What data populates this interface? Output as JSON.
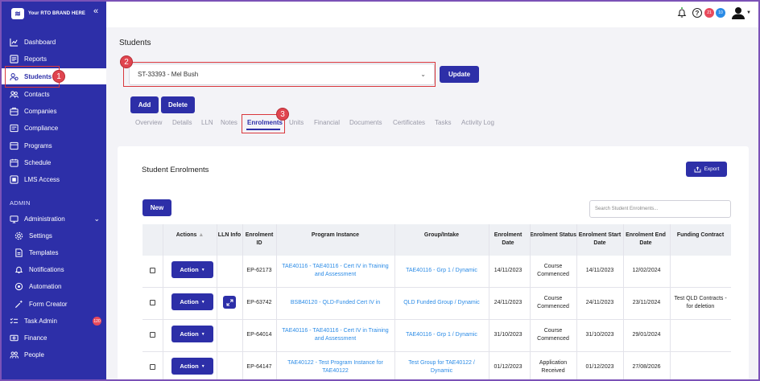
{
  "brand": {
    "name": "Your RTO BRAND HERE"
  },
  "sidebar": {
    "items": [
      {
        "label": "Dashboard",
        "icon": "chart-line-icon"
      },
      {
        "label": "Reports",
        "icon": "report-icon"
      },
      {
        "label": "Students",
        "icon": "students-icon"
      },
      {
        "label": "Contacts",
        "icon": "contacts-icon"
      },
      {
        "label": "Companies",
        "icon": "companies-icon"
      },
      {
        "label": "Compliance",
        "icon": "compliance-icon"
      },
      {
        "label": "Programs",
        "icon": "programs-icon"
      },
      {
        "label": "Schedule",
        "icon": "calendar-icon"
      },
      {
        "label": "LMS Access",
        "icon": "lms-icon"
      }
    ],
    "section_admin": "ADMIN",
    "admin_items": [
      {
        "label": "Administration",
        "icon": "admin-icon"
      },
      {
        "label": "Settings",
        "icon": "gear-icon"
      },
      {
        "label": "Templates",
        "icon": "template-icon"
      },
      {
        "label": "Notifications",
        "icon": "bell-icon"
      },
      {
        "label": "Automation",
        "icon": "automation-icon"
      },
      {
        "label": "Form Creator",
        "icon": "wand-icon"
      },
      {
        "label": "Task Admin",
        "icon": "tasks-icon",
        "badge": "120"
      },
      {
        "label": "Finance",
        "icon": "finance-icon"
      },
      {
        "label": "People",
        "icon": "people-icon"
      }
    ]
  },
  "topbar": {
    "badge_red": "21",
    "badge_blue": "10"
  },
  "page": {
    "title": "Students",
    "student_select": "ST-33393 - Mel Bush",
    "update_label": "Update",
    "add_label": "Add",
    "delete_label": "Delete",
    "tabs": [
      "Overview",
      "Details",
      "LLN",
      "Notes",
      "Enrolments",
      "Units",
      "Financial",
      "Documents",
      "Certificates",
      "Tasks",
      "Activity Log"
    ],
    "callouts": [
      "1",
      "2",
      "3"
    ]
  },
  "enrolments": {
    "title": "Student Enrolments",
    "export_label": "Export",
    "new_label": "New",
    "search_placeholder": "Search Student Enrolments...",
    "columns": {
      "actions": "Actions",
      "lln": "LLN Info",
      "enrolment_id": "Enrolment ID",
      "program": "Program Instance",
      "group": "Group/Intake",
      "enrol_date": "Enrolment Date",
      "status": "Enrolment Status",
      "start": "Enrolment Start Date",
      "end": "Enrolment End Date",
      "funding": "Funding Contract"
    },
    "action_label": "Action",
    "rows": [
      {
        "id": "EP-62173",
        "program": "TAE40116 - TAE40116 - Cert IV in Training and Assessment",
        "group": "TAE40116 - Grp 1 / Dynamic",
        "enrol_date": "14/11/2023",
        "status": "Course Commenced",
        "start": "14/11/2023",
        "end": "12/02/2024",
        "funding": ""
      },
      {
        "id": "EP-63742",
        "program": "BSB40120 - QLD-Funded Cert IV in",
        "group": "QLD Funded Group / Dynamic",
        "enrol_date": "24/11/2023",
        "status": "Course Commenced",
        "start": "24/11/2023",
        "end": "23/11/2024",
        "funding": "Test QLD Contracts - for deletion"
      },
      {
        "id": "EP-64014",
        "program": "TAE40116 - TAE40116 - Cert IV in Training and Assessment",
        "group": "TAE40116 - Grp 1 / Dynamic",
        "enrol_date": "31/10/2023",
        "status": "Course Commenced",
        "start": "31/10/2023",
        "end": "29/01/2024",
        "funding": ""
      },
      {
        "id": "EP-64147",
        "program": "TAE40122 - Test Program Instance for TAE40122",
        "group": "Test Group for TAE40122 / Dynamic",
        "enrol_date": "01/12/2023",
        "status": "Application Received",
        "start": "01/12/2023",
        "end": "27/08/2026",
        "funding": ""
      }
    ]
  }
}
